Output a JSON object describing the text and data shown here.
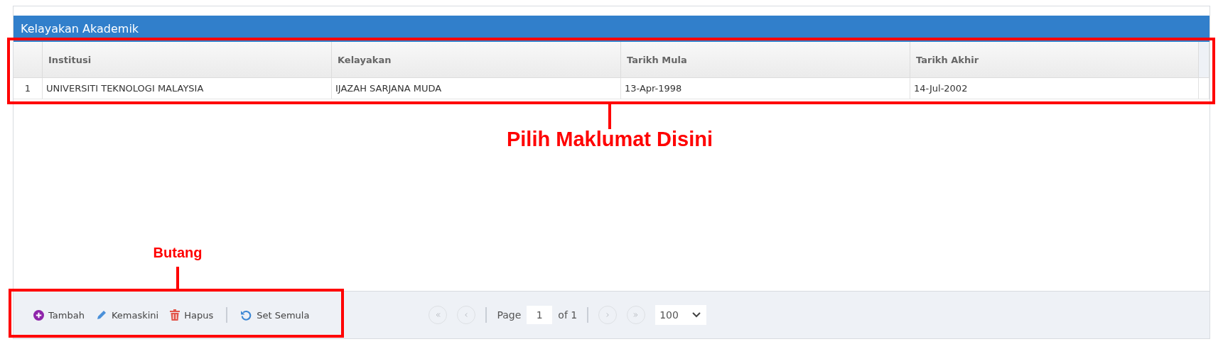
{
  "panel": {
    "title": "Kelayakan Akademik"
  },
  "table": {
    "columns": [
      "Institusi",
      "Kelayakan",
      "Tarikh Mula",
      "Tarikh Akhir"
    ],
    "rows": [
      {
        "number": "1",
        "cells": [
          "UNIVERSITI TEKNOLOGI MALAYSIA",
          "IJAZAH SARJANA MUDA",
          "13-Apr-1998",
          "14-Jul-2002"
        ]
      }
    ]
  },
  "toolbar": {
    "actions": [
      {
        "kind": "add",
        "label": "Tambah"
      },
      {
        "kind": "edit",
        "label": "Kemaskini"
      },
      {
        "kind": "delete",
        "label": "Hapus"
      },
      {
        "kind": "reset",
        "label": "Set Semula"
      }
    ]
  },
  "pager": {
    "nav": [
      {
        "kind": "first",
        "disabled": true
      },
      {
        "kind": "prev",
        "disabled": true
      },
      {
        "kind": "next",
        "disabled": true
      },
      {
        "kind": "last",
        "disabled": true
      }
    ],
    "page_label": "Page",
    "page": "1",
    "of_label": "of 1",
    "page_size": "100"
  },
  "annotations": [
    {
      "kind": "table",
      "label": "Pilih Maklumat Disini"
    },
    {
      "kind": "buttons",
      "label": "Butang"
    }
  ]
}
